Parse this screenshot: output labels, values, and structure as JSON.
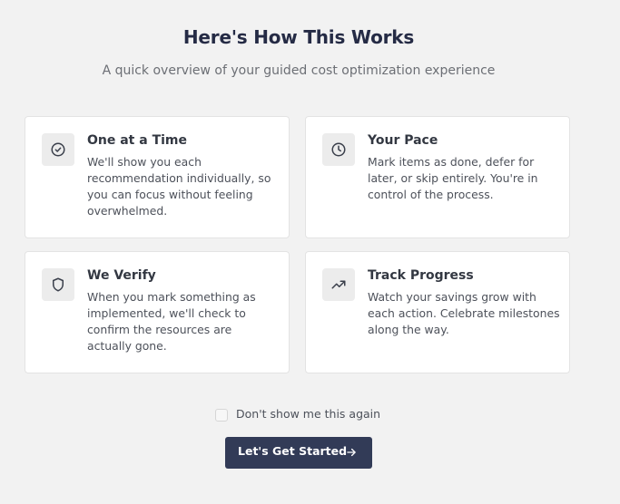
{
  "header": {
    "title": "Here's How This Works",
    "subtitle": "A quick overview of your guided cost optimization experience"
  },
  "cards": [
    {
      "icon": "check-circle-icon",
      "title": "One at a Time",
      "text": "We'll show you each recommendation individually, so you can focus without feeling overwhelmed."
    },
    {
      "icon": "clock-icon",
      "title": "Your Pace",
      "text": "Mark items as done, defer for later, or skip entirely. You're in control of the process."
    },
    {
      "icon": "shield-icon",
      "title": "We Verify",
      "text": "When you mark something as implemented, we'll check to confirm the resources are actually gone."
    },
    {
      "icon": "trending-up-icon",
      "title": "Track Progress",
      "text": "Watch your savings grow with each action. Celebrate milestones along the way."
    }
  ],
  "footer": {
    "checkbox_label": "Don't show me this again",
    "checkbox_checked": false,
    "button_label": "Let's Get Started",
    "button_icon": "arrow-right-icon"
  },
  "colors": {
    "background": "#f2f2f2",
    "card": "#ffffff",
    "title": "#252b45",
    "button": "#323b57",
    "icon_tile": "#ececec"
  }
}
